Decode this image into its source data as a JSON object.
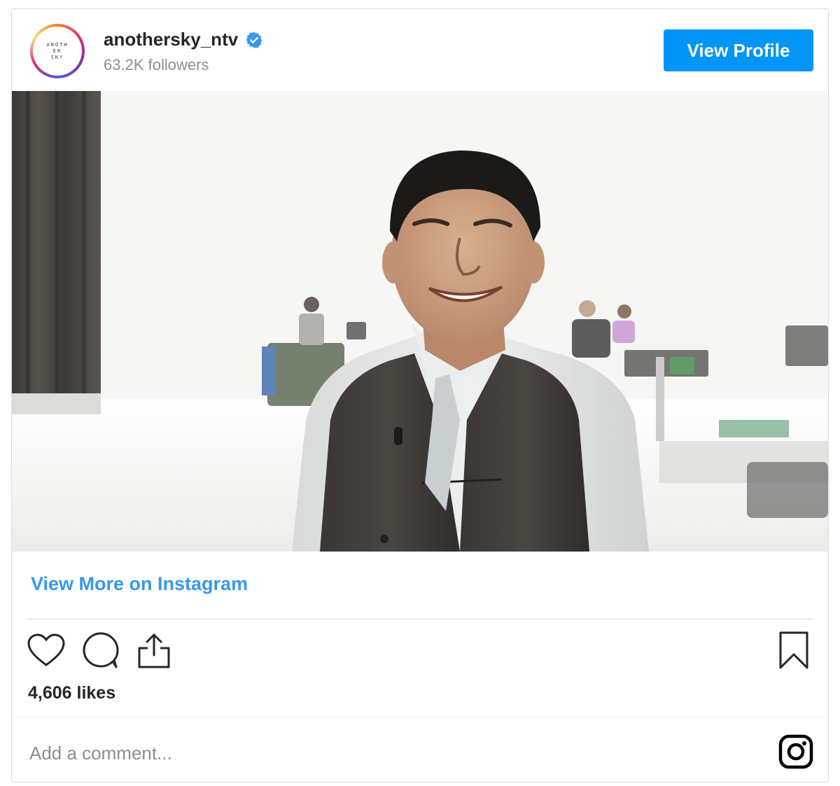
{
  "header": {
    "username": "anothersky_ntv",
    "verified": true,
    "followers": "63.2K followers",
    "view_profile_label": "View Profile",
    "avatar_logo_lines": [
      "ANOTH",
      "ER",
      "SKY"
    ]
  },
  "post": {
    "view_more_label": "View More on Instagram",
    "likes": "4,606 likes",
    "comment_placeholder": "Add a comment..."
  },
  "icons": {
    "like": "heart-icon",
    "comment": "comment-icon",
    "share": "share-icon",
    "save": "bookmark-icon",
    "instagram": "instagram-logo-icon",
    "verified": "verified-badge-icon"
  },
  "colors": {
    "primary_button": "#0095f6",
    "link": "#3897f0",
    "verified": "#3897f0",
    "text": "#262626",
    "muted": "#8e8e8e",
    "border": "#dbdbdb"
  }
}
